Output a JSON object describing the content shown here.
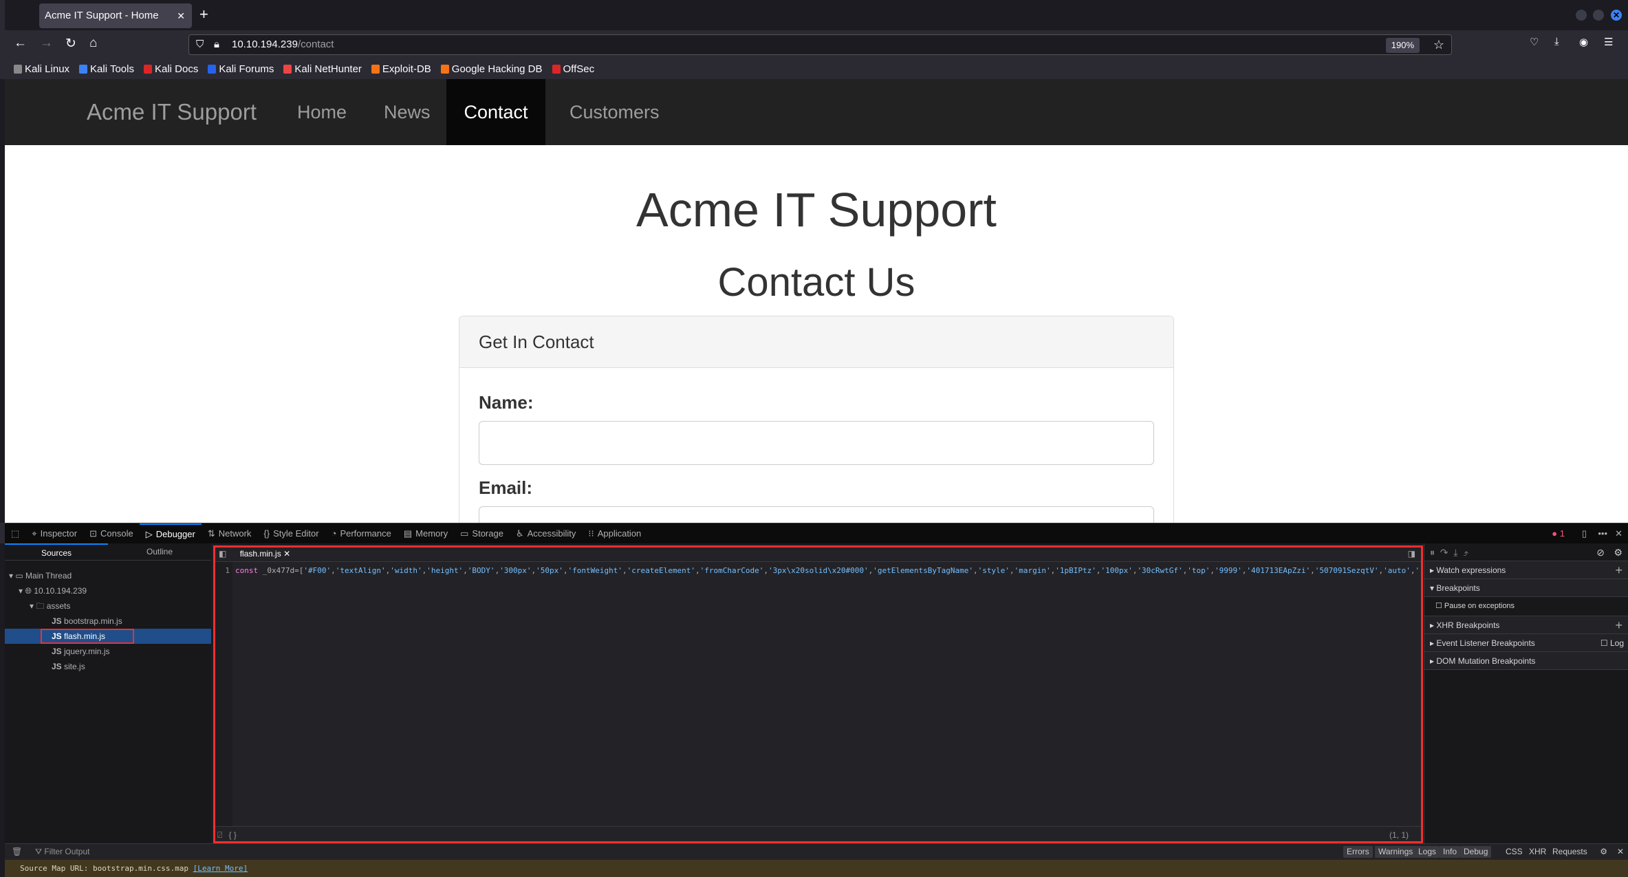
{
  "browser": {
    "tab_title": "Acme IT Support - Home",
    "url_host": "10.10.194.239",
    "url_path": "/contact",
    "zoom": "190%",
    "bookmarks": [
      {
        "label": "Kali Linux",
        "color": "#888"
      },
      {
        "label": "Kali Tools",
        "color": "#3b82f6"
      },
      {
        "label": "Kali Docs",
        "color": "#dc2626"
      },
      {
        "label": "Kali Forums",
        "color": "#2563eb"
      },
      {
        "label": "Kali NetHunter",
        "color": "#ef4444"
      },
      {
        "label": "Exploit-DB",
        "color": "#f97316"
      },
      {
        "label": "Google Hacking DB",
        "color": "#f97316"
      },
      {
        "label": "OffSec",
        "color": "#dc2626"
      }
    ]
  },
  "site": {
    "brand": "Acme IT Support",
    "nav": [
      "Home",
      "News",
      "Contact",
      "Customers"
    ],
    "active": "Contact",
    "heading": "Acme IT Support",
    "subheading": "Contact Us",
    "card_title": "Get In Contact",
    "name_label": "Name:",
    "email_label": "Email:"
  },
  "devtools": {
    "tabs": [
      "Inspector",
      "Console",
      "Debugger",
      "Network",
      "Style Editor",
      "Performance",
      "Memory",
      "Storage",
      "Accessibility",
      "Application"
    ],
    "active_tab": "Debugger",
    "error_count": "1",
    "sources_tab": "Sources",
    "outline_tab": "Outline",
    "tree": {
      "thread": "Main Thread",
      "host": "10.10.194.239",
      "folder": "assets",
      "files": [
        "bootstrap.min.js",
        "flash.min.js",
        "jquery.min.js",
        "site.js"
      ],
      "selected": "flash.min.js"
    },
    "editor": {
      "file": "flash.min.js",
      "line_number": "1",
      "keyword": "const",
      "identifier": "_0x477d",
      "operator": "=[",
      "strings": [
        "'#F00'",
        "'textAlign'",
        "'width'",
        "'height'",
        "'BODY'",
        "'300px'",
        "'50px'",
        "'fontWeight'",
        "'createElement'",
        "'fromCharCode'",
        "'3px\\x20solid\\x20#000'",
        "'getElementsByTagName'",
        "'style'",
        "'margin'",
        "'1pBIPtz'",
        "'100px'",
        "'30cRwtGf'",
        "'top'",
        "'9999'",
        "'401713EApZzi'",
        "'507091SezqtV'",
        "'auto'",
        "'"
      ],
      "cursor": "(1, 1)",
      "pretty_print": "{ }"
    },
    "right_panel": {
      "watch": "Watch expressions",
      "breakpoints": "Breakpoints",
      "pause_exceptions": "Pause on exceptions",
      "xhr": "XHR Breakpoints",
      "event": "Event Listener Breakpoints",
      "log": "Log",
      "dom": "DOM Mutation Breakpoints"
    },
    "console": {
      "filter_placeholder": "Filter Output",
      "filters": [
        "Errors",
        "Warnings",
        "Logs",
        "Info",
        "Debug"
      ],
      "extra": [
        "CSS",
        "XHR",
        "Requests"
      ],
      "message": "Source Map URL: bootstrap.min.css.map",
      "learn_more": "[Learn More]"
    }
  }
}
